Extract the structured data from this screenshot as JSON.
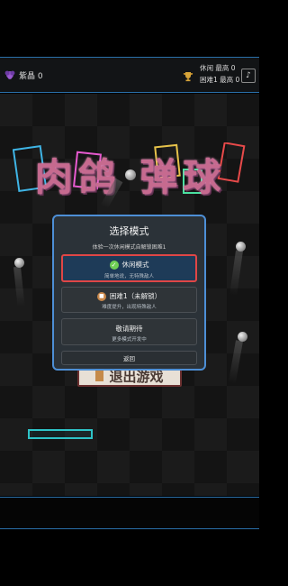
{
  "topbar": {
    "gem_label": "紫晶 0",
    "score_casual": "休闲 最高 0",
    "score_hard": "困难1 最高 0",
    "music_icon": "♪"
  },
  "logo": {
    "text": "肉鸽 弹球"
  },
  "background": {
    "exit_label": "退出游戏"
  },
  "modal": {
    "title": "选择模式",
    "subtitle": "体验一次休闲模式自解锁困难1",
    "options": [
      {
        "title": "休闲模式",
        "desc": "简单地说，无特殊敌人",
        "icon": "check-icon",
        "selected": true
      },
      {
        "title": "困难1（未解锁）",
        "desc": "难度提升，出现特殊敌人",
        "icon": "lock-icon",
        "selected": false
      },
      {
        "title": "敬请期待",
        "desc": "更多模式开发中",
        "icon": "",
        "selected": false
      }
    ],
    "back_label": "返回"
  },
  "colors": {
    "accent": "#4d8fd6",
    "selected_border": "#e04646",
    "paddle": "#2ec3c7"
  }
}
